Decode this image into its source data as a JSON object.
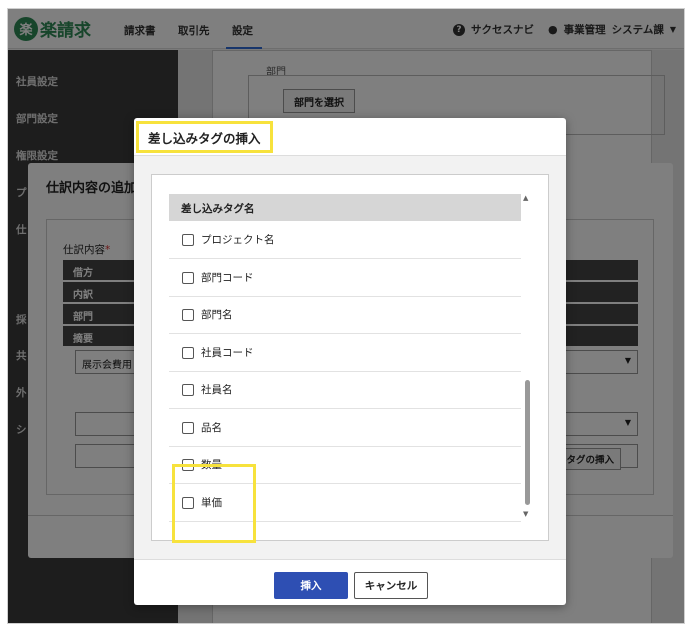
{
  "app": {
    "logo_mark": "楽",
    "logo_text": "楽請求",
    "nav": [
      "請求書",
      "取引先",
      "設定"
    ],
    "help_label": "サクセスナビ",
    "user_label": "事業管理",
    "dept_label": "システム課"
  },
  "sidebar": {
    "items": [
      "社員設定",
      "部門設定",
      "権限設定",
      "プ",
      "仕",
      "採",
      "共",
      "外",
      "シ"
    ]
  },
  "background_page": {
    "field_label": "部門",
    "select_dept_button": "部門を選択"
  },
  "background_dialog": {
    "title": "仕訳内容の追加",
    "field_label": "仕訳内容",
    "required_mark": "*",
    "rows": [
      "借方",
      "内訳",
      "部門",
      "摘要"
    ],
    "select_value": "展示会費用",
    "insert_tag_button": "みタグの挿入"
  },
  "modal": {
    "title": "差し込みタグの挿入",
    "list_header": "差し込みタグ名",
    "items": [
      {
        "label": "プロジェクト名",
        "checked": false
      },
      {
        "label": "部門コード",
        "checked": false
      },
      {
        "label": "部門名",
        "checked": false
      },
      {
        "label": "社員コード",
        "checked": false
      },
      {
        "label": "社員名",
        "checked": false
      },
      {
        "label": "品名",
        "checked": false
      },
      {
        "label": "数量",
        "checked": false
      },
      {
        "label": "単価",
        "checked": false
      }
    ],
    "insert_button": "挿入",
    "cancel_button": "キャンセル"
  },
  "colors": {
    "brand": "#2e8b57",
    "primary_button": "#2e4fb3",
    "highlight": "#f7e23c"
  }
}
